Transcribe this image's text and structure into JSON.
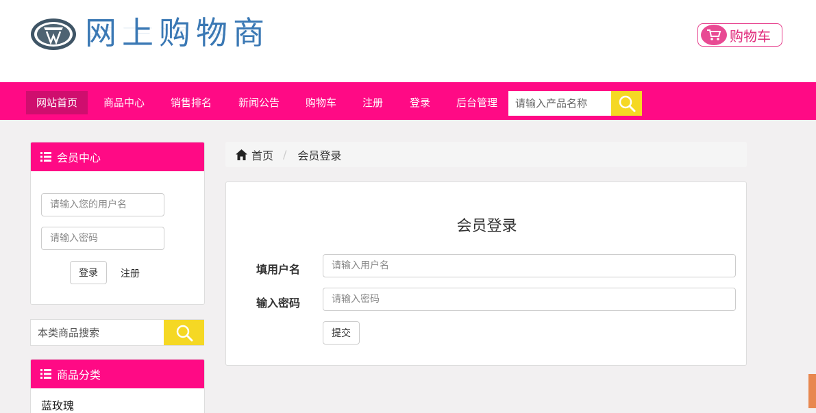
{
  "header": {
    "logo_text": "网上购物商",
    "cart_label": "购物车"
  },
  "nav": {
    "items": [
      "网站首页",
      "商品中心",
      "销售排名",
      "新闻公告",
      "购物车",
      "注册",
      "登录",
      "后台管理"
    ],
    "search_placeholder": "请输入产品名称"
  },
  "sidebar": {
    "member_title": "会员中心",
    "username_placeholder": "请输入您的用户名",
    "password_placeholder": "请输入密码",
    "login_label": "登录",
    "register_label": "注册",
    "category_search_placeholder": "本类商品搜索",
    "category_title": "商品分类",
    "categories": [
      "蓝玫瑰"
    ]
  },
  "breadcrumb": {
    "home": "首页",
    "current": "会员登录"
  },
  "login_form": {
    "title": "会员登录",
    "username_label": "填用户名",
    "username_placeholder": "请输入用户名",
    "password_label": "输入密码",
    "password_placeholder": "请输入密码",
    "submit_label": "提交"
  },
  "colors": {
    "brand_pink": "#ff0a85",
    "active_nav": "#cf0e6e",
    "search_yellow": "#f5d824",
    "logo_blue": "#3a78b4"
  }
}
